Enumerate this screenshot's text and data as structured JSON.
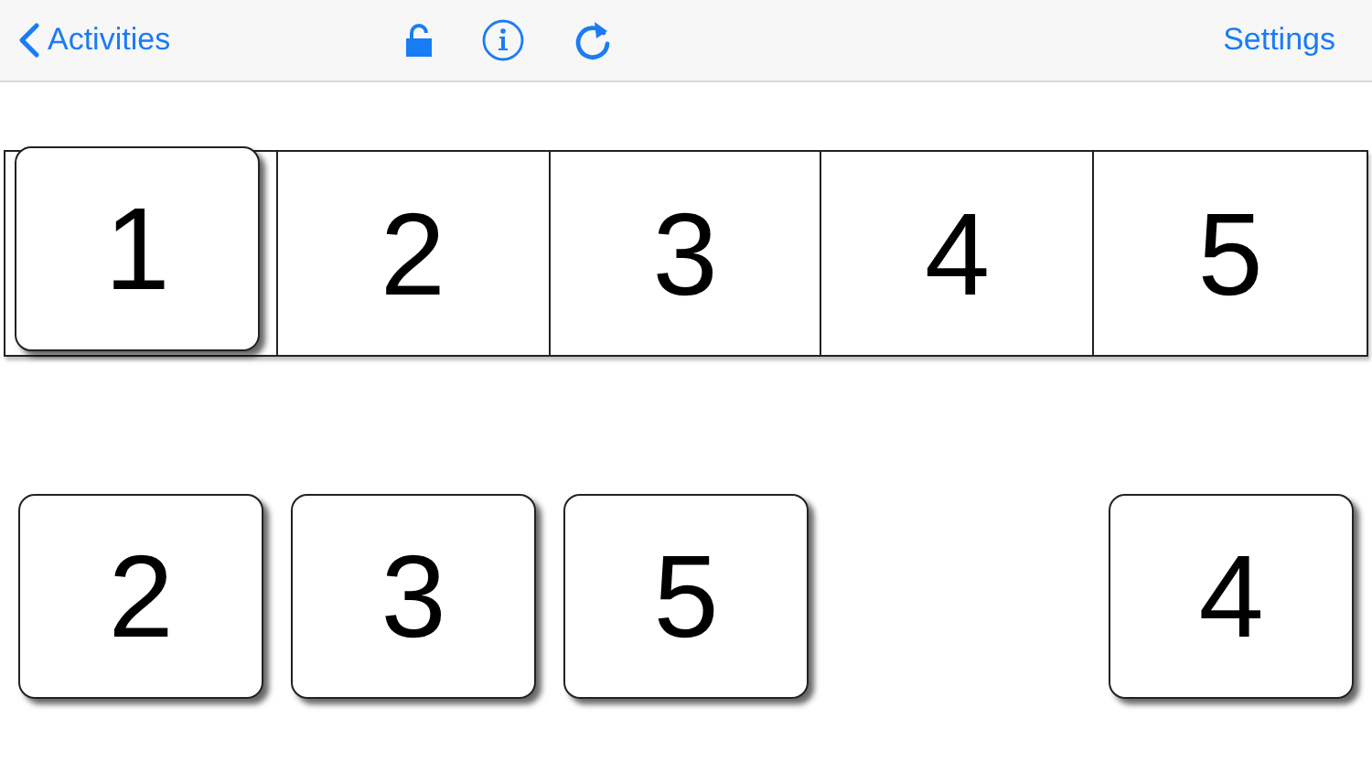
{
  "navbar": {
    "back_label": "Activities",
    "settings_label": "Settings"
  },
  "strip": [
    {
      "kind": "tile",
      "label": "1"
    },
    {
      "kind": "cell",
      "label": "2"
    },
    {
      "kind": "cell",
      "label": "3"
    },
    {
      "kind": "cell",
      "label": "4"
    },
    {
      "kind": "cell",
      "label": "5"
    }
  ],
  "tray": [
    {
      "kind": "tile",
      "label": "2"
    },
    {
      "kind": "tile",
      "label": "3"
    },
    {
      "kind": "tile",
      "label": "5"
    },
    {
      "kind": "empty"
    },
    {
      "kind": "tile",
      "label": "4"
    }
  ]
}
